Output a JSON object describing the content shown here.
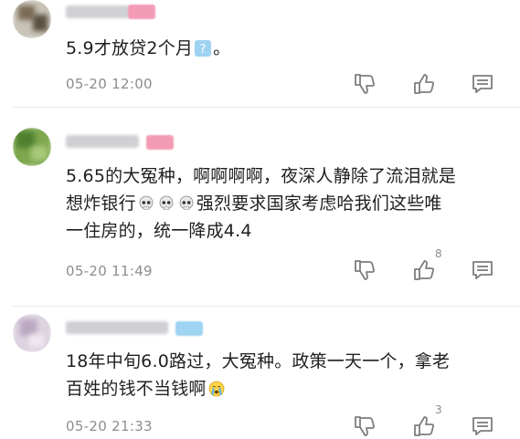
{
  "comments": [
    {
      "text": "5.9才放贷2个月",
      "text_suffix": "。",
      "emoji": "question-emoji",
      "time": "05-20 12:00",
      "like_count": ""
    },
    {
      "text_line1": "5.65的大冤种，啊啊啊啊，夜深人静除了流泪就是",
      "text_line2_prefix": "想炸银行",
      "text_line2_suffix": "强烈要求国家考虑哈我们这些唯",
      "text_line3": "一住房的，统一降成4.4",
      "emoji": "skull-emoji",
      "time": "05-20 11:49",
      "like_count": "8"
    },
    {
      "text_line1": "18年中旬6.0路过，大冤种。政策一天一个，拿老",
      "text_line2": "百姓的钱不当钱啊",
      "emoji": "crying-face-emoji",
      "time": "05-20 21:33",
      "like_count": "3"
    }
  ],
  "colors": {
    "text": "#1f1f1f",
    "meta": "#8d8d8d",
    "icon": "#7d7d7d",
    "badge_pink": "#f39bb5",
    "badge_blue": "#9fd3f2"
  }
}
